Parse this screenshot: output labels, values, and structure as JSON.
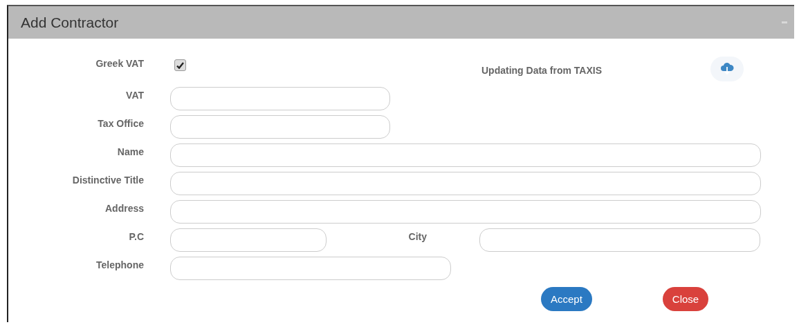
{
  "window": {
    "title": "Add Contractor"
  },
  "rows": [
    {
      "kind": "checkbox",
      "label": "Greek VAT",
      "checked": true,
      "note": "Updating Data from TAXIS"
    },
    {
      "kind": "text",
      "label": "VAT"
    },
    {
      "kind": "text",
      "label": "Tax Office"
    },
    {
      "kind": "text",
      "label": "Name"
    },
    {
      "kind": "text",
      "label": "Distinctive Title"
    },
    {
      "kind": "text",
      "label": "Address"
    },
    {
      "kind": "pair",
      "label": "P.C",
      "label_2": "City"
    },
    {
      "kind": "text",
      "label": "Telephone"
    }
  ],
  "buttons": [
    {
      "label": "Accept",
      "kind": "primary"
    },
    {
      "label": "Close",
      "kind": "danger"
    }
  ]
}
